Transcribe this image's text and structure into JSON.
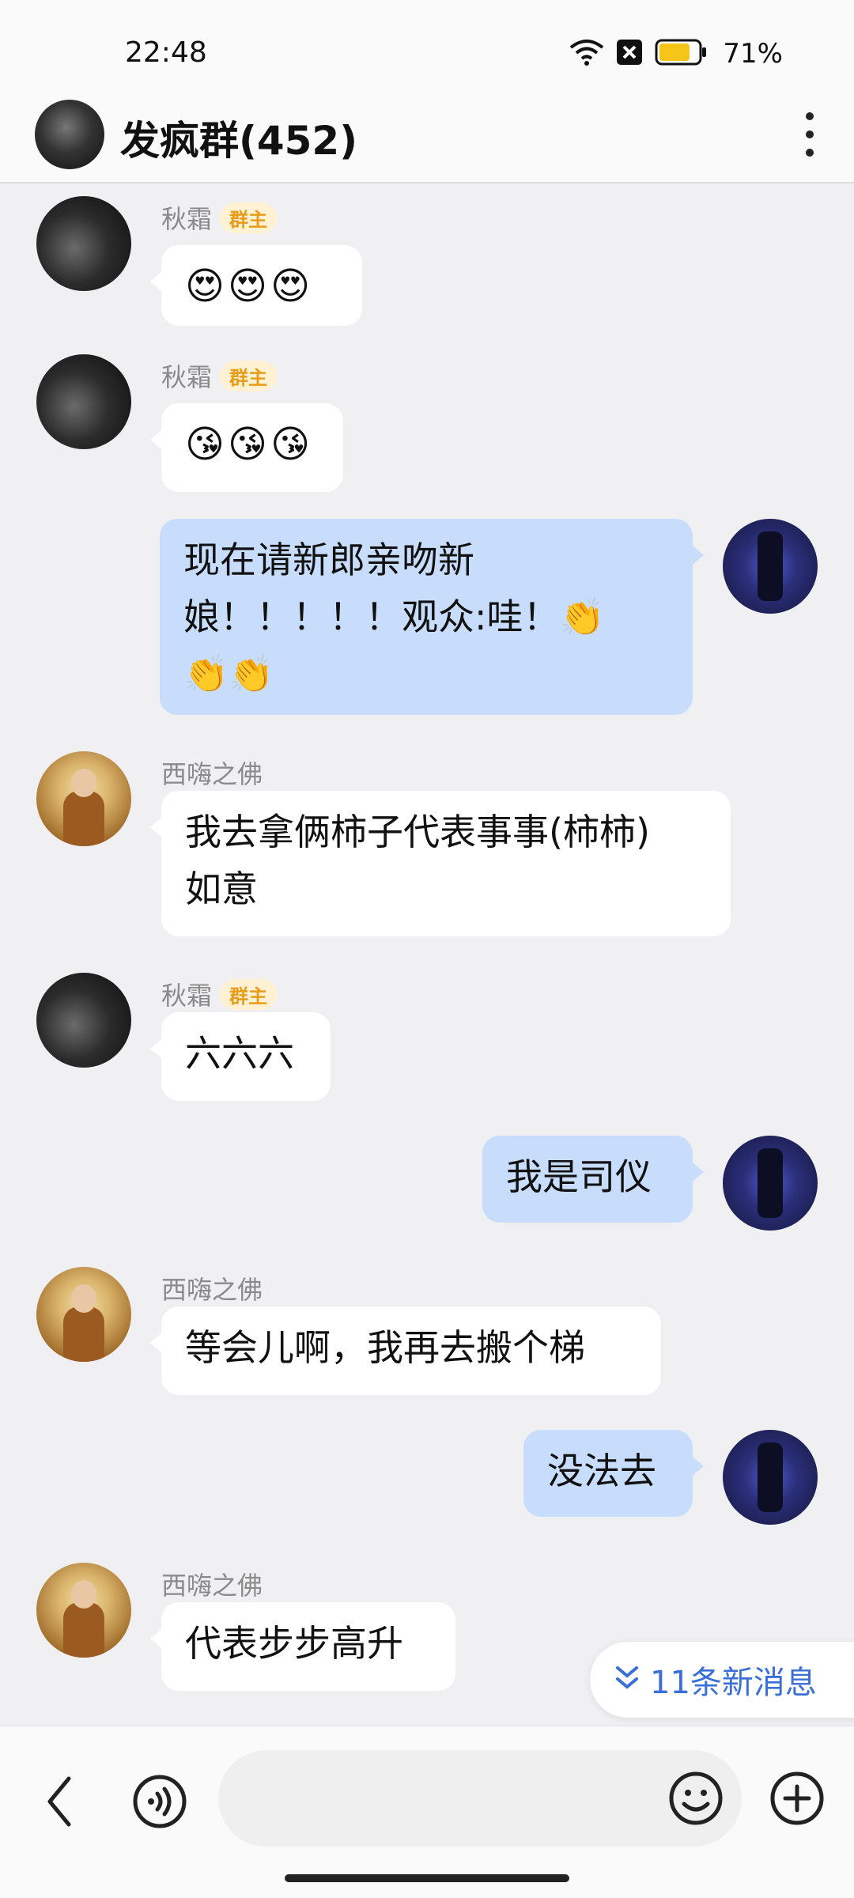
{
  "status": {
    "time": "22:48",
    "battery": "71%",
    "icons": [
      "wifi-icon",
      "sim-off-icon",
      "battery-icon"
    ]
  },
  "header": {
    "title": "发疯群(452)",
    "more_icon": "more-vertical-icon"
  },
  "messages": [
    {
      "sender": "秋霜",
      "badge": "群主",
      "text": "😍😍😍",
      "side": "left"
    },
    {
      "sender": "秋霜",
      "badge": "群主",
      "text": "😘😘😘",
      "side": "left"
    },
    {
      "sender": "",
      "text_lines": [
        "现在请新郎亲吻新",
        "娘！！！！！观众:哇！👏",
        "👏👏"
      ],
      "side": "right"
    },
    {
      "sender": "西嗨之佛",
      "text_lines": [
        "我去拿俩柿子代表事事(柿柿)",
        "如意"
      ],
      "side": "left"
    },
    {
      "sender": "秋霜",
      "badge": "群主",
      "text": "六六六",
      "side": "left"
    },
    {
      "sender": "",
      "text": "我是司仪",
      "side": "right"
    },
    {
      "sender": "西嗨之佛",
      "text": "等会儿啊，我再去搬个梯",
      "side": "left"
    },
    {
      "sender": "",
      "text": "没法去",
      "side": "right"
    },
    {
      "sender": "西嗨之佛",
      "text": "代表步步高升",
      "side": "left"
    }
  ],
  "new_messages": {
    "label": "11条新消息"
  },
  "input_bar": {
    "placeholder": "",
    "icons": [
      "back-icon",
      "voice-icon",
      "emoji-icon",
      "plus-icon"
    ]
  },
  "colors": {
    "background": "#f0f0f2",
    "self_bubble": "#c8ddfb",
    "other_bubble": "#ffffff",
    "badge_text": "#e89c1a",
    "accent": "#3a6fd8"
  }
}
